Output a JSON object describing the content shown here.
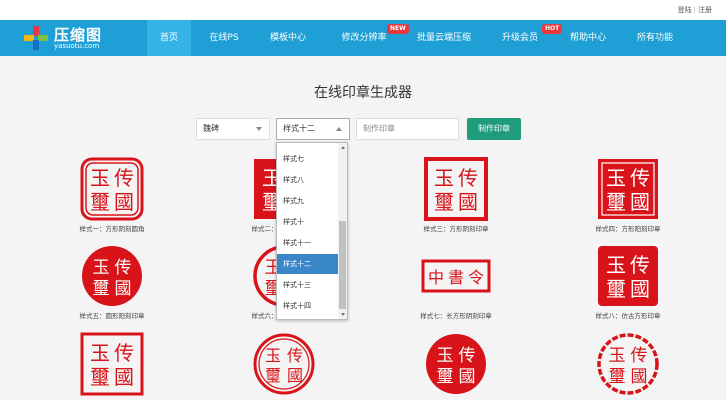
{
  "topbar": {
    "login": "登陆",
    "separator": "|",
    "register": "注册"
  },
  "logo": {
    "name": "压缩图",
    "domain": "yasuotu.com"
  },
  "nav": {
    "items": [
      {
        "label": "首页",
        "active": true
      },
      {
        "label": "在线PS"
      },
      {
        "label": "模板中心"
      },
      {
        "label": "修改分辨率",
        "badge": "NEW"
      },
      {
        "label": "批量云端压缩"
      },
      {
        "label": "升级会员",
        "badge": "HOT"
      },
      {
        "label": "帮助中心"
      },
      {
        "label": "所有功能"
      }
    ]
  },
  "page": {
    "title": "在线印章生成器"
  },
  "form": {
    "font_select": "魏碑",
    "style_select": "样式十二",
    "text_placeholder": "制作印章",
    "submit": "制作印章"
  },
  "dropdown": {
    "options": [
      "样式七",
      "样式八",
      "样式九",
      "样式十",
      "样式十一",
      "样式十二",
      "样式十三",
      "样式十四"
    ],
    "selected_index": 5
  },
  "stamps": [
    {
      "caption": "样式一：方形阴刻圆角",
      "chars": [
        "传",
        "國",
        "玉",
        "璽"
      ]
    },
    {
      "caption": "样式二：方形阳刻印章",
      "chars": [
        "传",
        "國",
        "玉",
        "璽"
      ]
    },
    {
      "caption": "样式三：方形阴刻印章",
      "chars": [
        "传",
        "國",
        "玉",
        "璽"
      ]
    },
    {
      "caption": "样式四：方形阳刻印章",
      "chars": [
        "传",
        "國",
        "玉",
        "璽"
      ]
    },
    {
      "caption": "样式五：圆形阳刻印章",
      "chars": [
        "传",
        "國",
        "玉",
        "璽"
      ]
    },
    {
      "caption": "样式六：圆形阴刻印章",
      "chars": [
        "传",
        "國",
        "玉",
        "璽"
      ]
    },
    {
      "caption": "样式七：长方形阴刻印章",
      "chars": [
        "中",
        "書",
        "令"
      ]
    },
    {
      "caption": "样式八：仿古方形印章",
      "chars": [
        "传",
        "國",
        "玉",
        "璽"
      ]
    },
    {
      "caption": "",
      "chars": [
        "传",
        "國",
        "玉",
        "璽"
      ]
    },
    {
      "caption": "",
      "chars": [
        "传",
        "國",
        "玉",
        "璽"
      ]
    },
    {
      "caption": "",
      "chars": [
        "传",
        "國",
        "玉",
        "璽"
      ]
    },
    {
      "caption": "",
      "chars": [
        "传",
        "國",
        "玉",
        "璽"
      ]
    }
  ],
  "colors": {
    "nav": "#1ea0d6",
    "stamp": "#d8141a",
    "button": "#1e9c7c",
    "selected_option": "#3a87c8"
  }
}
